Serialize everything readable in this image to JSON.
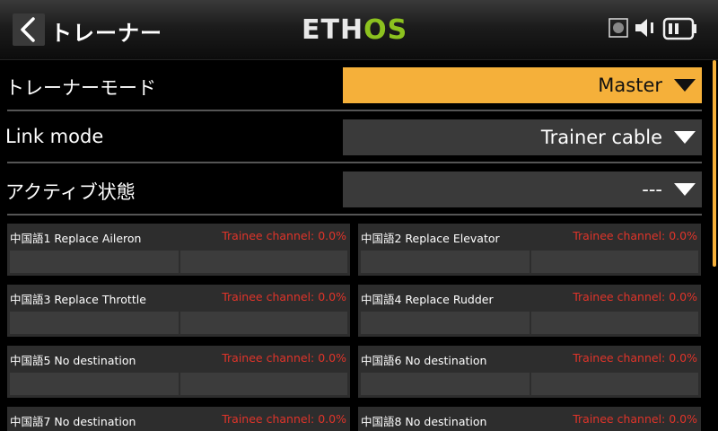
{
  "header": {
    "title": "トレーナー",
    "logo_left": "ETH",
    "logo_right": "OS",
    "icons": [
      "back-arrow-icon",
      "record-icon",
      "speaker-icon",
      "battery-icon"
    ]
  },
  "settings": [
    {
      "label": "トレーナーモード",
      "value": "Master",
      "active": true
    },
    {
      "label": "Link mode",
      "value": "Trainer cable",
      "active": false
    },
    {
      "label": "アクティブ状態",
      "value": "---",
      "active": false
    }
  ],
  "channels": [
    {
      "name": "中国語1 Replace Aileron",
      "trainee": "Trainee channel: 0.0%"
    },
    {
      "name": "中国語2 Replace Elevator",
      "trainee": "Trainee channel: 0.0%"
    },
    {
      "name": "中国語3 Replace Throttle",
      "trainee": "Trainee channel: 0.0%"
    },
    {
      "name": "中国語4 Replace Rudder",
      "trainee": "Trainee channel: 0.0%"
    },
    {
      "name": "中国語5 No destination",
      "trainee": "Trainee channel: 0.0%"
    },
    {
      "name": "中国語6 No destination",
      "trainee": "Trainee channel: 0.0%"
    },
    {
      "name": "中国語7 No destination",
      "trainee": "Trainee channel: 0.0%"
    },
    {
      "name": "中国語8 No destination",
      "trainee": "Trainee channel: 0.0%"
    }
  ],
  "colors": {
    "accent": "#f5b03a",
    "trainee_text": "#e0342a",
    "logo_green": "#8cc21f"
  }
}
